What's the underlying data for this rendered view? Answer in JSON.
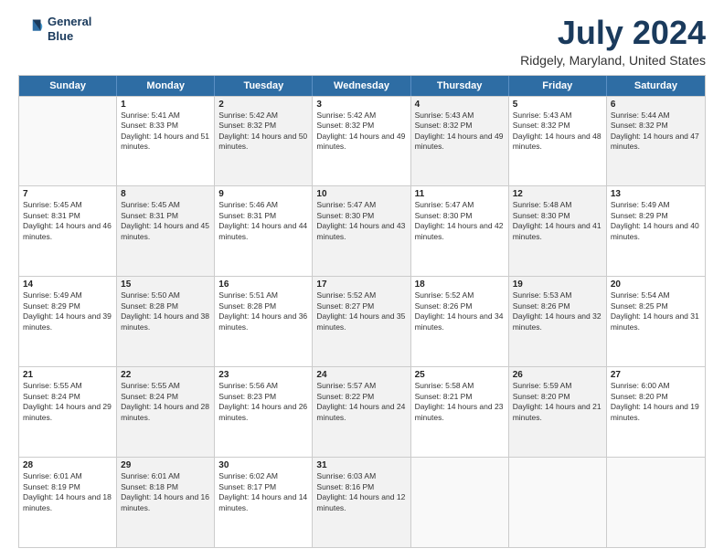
{
  "header": {
    "logo": {
      "line1": "General",
      "line2": "Blue"
    },
    "title": "July 2024",
    "subtitle": "Ridgely, Maryland, United States"
  },
  "calendar": {
    "days": [
      "Sunday",
      "Monday",
      "Tuesday",
      "Wednesday",
      "Thursday",
      "Friday",
      "Saturday"
    ],
    "rows": [
      [
        {
          "day": "",
          "empty": true,
          "shaded": false
        },
        {
          "day": "1",
          "empty": false,
          "shaded": false,
          "sunrise": "5:41 AM",
          "sunset": "8:33 PM",
          "daylight": "14 hours and 51 minutes."
        },
        {
          "day": "2",
          "empty": false,
          "shaded": true,
          "sunrise": "5:42 AM",
          "sunset": "8:32 PM",
          "daylight": "14 hours and 50 minutes."
        },
        {
          "day": "3",
          "empty": false,
          "shaded": false,
          "sunrise": "5:42 AM",
          "sunset": "8:32 PM",
          "daylight": "14 hours and 49 minutes."
        },
        {
          "day": "4",
          "empty": false,
          "shaded": true,
          "sunrise": "5:43 AM",
          "sunset": "8:32 PM",
          "daylight": "14 hours and 49 minutes."
        },
        {
          "day": "5",
          "empty": false,
          "shaded": false,
          "sunrise": "5:43 AM",
          "sunset": "8:32 PM",
          "daylight": "14 hours and 48 minutes."
        },
        {
          "day": "6",
          "empty": false,
          "shaded": true,
          "sunrise": "5:44 AM",
          "sunset": "8:32 PM",
          "daylight": "14 hours and 47 minutes."
        }
      ],
      [
        {
          "day": "7",
          "empty": false,
          "shaded": false,
          "sunrise": "5:45 AM",
          "sunset": "8:31 PM",
          "daylight": "14 hours and 46 minutes."
        },
        {
          "day": "8",
          "empty": false,
          "shaded": true,
          "sunrise": "5:45 AM",
          "sunset": "8:31 PM",
          "daylight": "14 hours and 45 minutes."
        },
        {
          "day": "9",
          "empty": false,
          "shaded": false,
          "sunrise": "5:46 AM",
          "sunset": "8:31 PM",
          "daylight": "14 hours and 44 minutes."
        },
        {
          "day": "10",
          "empty": false,
          "shaded": true,
          "sunrise": "5:47 AM",
          "sunset": "8:30 PM",
          "daylight": "14 hours and 43 minutes."
        },
        {
          "day": "11",
          "empty": false,
          "shaded": false,
          "sunrise": "5:47 AM",
          "sunset": "8:30 PM",
          "daylight": "14 hours and 42 minutes."
        },
        {
          "day": "12",
          "empty": false,
          "shaded": true,
          "sunrise": "5:48 AM",
          "sunset": "8:30 PM",
          "daylight": "14 hours and 41 minutes."
        },
        {
          "day": "13",
          "empty": false,
          "shaded": false,
          "sunrise": "5:49 AM",
          "sunset": "8:29 PM",
          "daylight": "14 hours and 40 minutes."
        }
      ],
      [
        {
          "day": "14",
          "empty": false,
          "shaded": false,
          "sunrise": "5:49 AM",
          "sunset": "8:29 PM",
          "daylight": "14 hours and 39 minutes."
        },
        {
          "day": "15",
          "empty": false,
          "shaded": true,
          "sunrise": "5:50 AM",
          "sunset": "8:28 PM",
          "daylight": "14 hours and 38 minutes."
        },
        {
          "day": "16",
          "empty": false,
          "shaded": false,
          "sunrise": "5:51 AM",
          "sunset": "8:28 PM",
          "daylight": "14 hours and 36 minutes."
        },
        {
          "day": "17",
          "empty": false,
          "shaded": true,
          "sunrise": "5:52 AM",
          "sunset": "8:27 PM",
          "daylight": "14 hours and 35 minutes."
        },
        {
          "day": "18",
          "empty": false,
          "shaded": false,
          "sunrise": "5:52 AM",
          "sunset": "8:26 PM",
          "daylight": "14 hours and 34 minutes."
        },
        {
          "day": "19",
          "empty": false,
          "shaded": true,
          "sunrise": "5:53 AM",
          "sunset": "8:26 PM",
          "daylight": "14 hours and 32 minutes."
        },
        {
          "day": "20",
          "empty": false,
          "shaded": false,
          "sunrise": "5:54 AM",
          "sunset": "8:25 PM",
          "daylight": "14 hours and 31 minutes."
        }
      ],
      [
        {
          "day": "21",
          "empty": false,
          "shaded": false,
          "sunrise": "5:55 AM",
          "sunset": "8:24 PM",
          "daylight": "14 hours and 29 minutes."
        },
        {
          "day": "22",
          "empty": false,
          "shaded": true,
          "sunrise": "5:55 AM",
          "sunset": "8:24 PM",
          "daylight": "14 hours and 28 minutes."
        },
        {
          "day": "23",
          "empty": false,
          "shaded": false,
          "sunrise": "5:56 AM",
          "sunset": "8:23 PM",
          "daylight": "14 hours and 26 minutes."
        },
        {
          "day": "24",
          "empty": false,
          "shaded": true,
          "sunrise": "5:57 AM",
          "sunset": "8:22 PM",
          "daylight": "14 hours and 24 minutes."
        },
        {
          "day": "25",
          "empty": false,
          "shaded": false,
          "sunrise": "5:58 AM",
          "sunset": "8:21 PM",
          "daylight": "14 hours and 23 minutes."
        },
        {
          "day": "26",
          "empty": false,
          "shaded": true,
          "sunrise": "5:59 AM",
          "sunset": "8:20 PM",
          "daylight": "14 hours and 21 minutes."
        },
        {
          "day": "27",
          "empty": false,
          "shaded": false,
          "sunrise": "6:00 AM",
          "sunset": "8:20 PM",
          "daylight": "14 hours and 19 minutes."
        }
      ],
      [
        {
          "day": "28",
          "empty": false,
          "shaded": false,
          "sunrise": "6:01 AM",
          "sunset": "8:19 PM",
          "daylight": "14 hours and 18 minutes."
        },
        {
          "day": "29",
          "empty": false,
          "shaded": true,
          "sunrise": "6:01 AM",
          "sunset": "8:18 PM",
          "daylight": "14 hours and 16 minutes."
        },
        {
          "day": "30",
          "empty": false,
          "shaded": false,
          "sunrise": "6:02 AM",
          "sunset": "8:17 PM",
          "daylight": "14 hours and 14 minutes."
        },
        {
          "day": "31",
          "empty": false,
          "shaded": true,
          "sunrise": "6:03 AM",
          "sunset": "8:16 PM",
          "daylight": "14 hours and 12 minutes."
        },
        {
          "day": "",
          "empty": true,
          "shaded": false
        },
        {
          "day": "",
          "empty": true,
          "shaded": false
        },
        {
          "day": "",
          "empty": true,
          "shaded": false
        }
      ]
    ]
  }
}
